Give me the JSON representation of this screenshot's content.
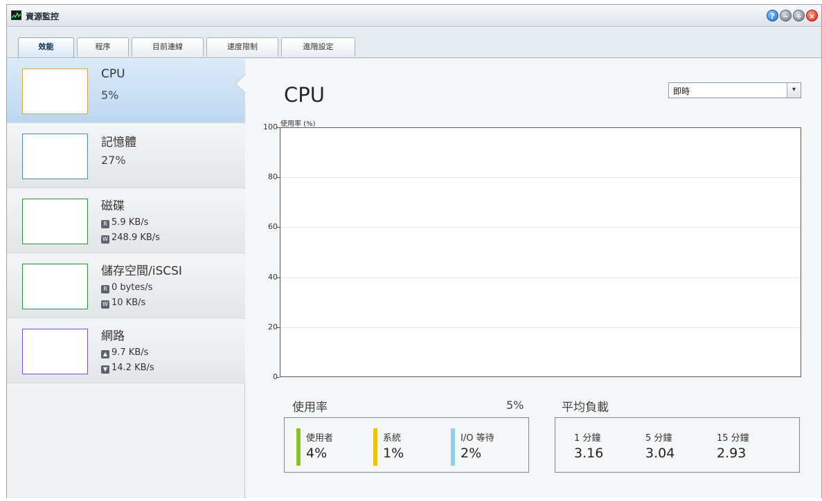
{
  "window": {
    "title": "資源監控",
    "buttons": {
      "help": "?",
      "minimize": "−",
      "maximize": "+",
      "close": "×"
    }
  },
  "tabs": [
    {
      "label": "效能",
      "active": true
    },
    {
      "label": "程序",
      "active": false
    },
    {
      "label": "目前連線",
      "active": false
    },
    {
      "label": "速度限制",
      "active": false
    },
    {
      "label": "進階設定",
      "active": false
    }
  ],
  "sidebar": {
    "items": [
      {
        "name": "CPU",
        "value": "5%",
        "color": "#d9a34a"
      },
      {
        "name": "記憶體",
        "value": "27%",
        "color": "#4d8ea6"
      },
      {
        "name": "磁碟",
        "read_badge": "R",
        "read": "5.9 KB/s",
        "write_badge": "W",
        "write": "248.9 KB/s",
        "color": "#2e8a3a"
      },
      {
        "name": "儲存空間/iSCSI",
        "read_badge": "R",
        "read": "0 bytes/s",
        "write_badge": "W",
        "write": "10 KB/s",
        "color": "#2e8a3a"
      },
      {
        "name": "網路",
        "up_icon": "upload-arrow-icon",
        "up": "9.7 KB/s",
        "down_icon": "download-arrow-icon",
        "down": "14.2 KB/s",
        "color": "#7b4fc4"
      }
    ]
  },
  "main": {
    "title": "CPU",
    "range_select": {
      "selected": "即時"
    }
  },
  "chart_data": {
    "type": "line",
    "ylabel": "使用率 (%)",
    "ylim": [
      0,
      100
    ],
    "yticks": [
      "0",
      "20",
      "40",
      "60",
      "80",
      "100"
    ],
    "grid": true,
    "series": []
  },
  "usage": {
    "label": "使用率",
    "total": "5%",
    "items": [
      {
        "label": "使用者",
        "value": "4%",
        "color": "#8cc21f"
      },
      {
        "label": "系統",
        "value": "1%",
        "color": "#f2c200"
      },
      {
        "label": "I/O 等待",
        "value": "2%",
        "color": "#8fd0f0"
      }
    ]
  },
  "load": {
    "label": "平均負載",
    "items": [
      {
        "label": "1 分鐘",
        "value": "3.16"
      },
      {
        "label": "5 分鐘",
        "value": "3.04"
      },
      {
        "label": "15 分鐘",
        "value": "2.93"
      }
    ]
  },
  "colors": {
    "accent": "#bcd7f1",
    "window_bg": "#f4f6f8"
  }
}
